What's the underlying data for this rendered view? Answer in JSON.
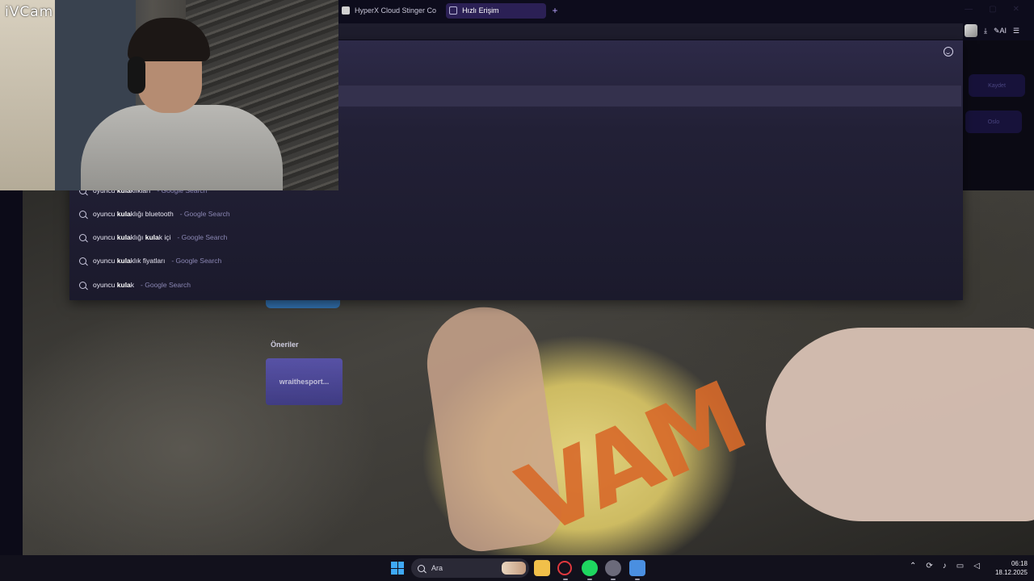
{
  "webcam": {
    "logo": "iVCam"
  },
  "tabs": [
    {
      "label": "HyperX Cloud Stinger Co",
      "active": false,
      "icon": "page-icon"
    },
    {
      "label": "Hızlı Erişim",
      "active": true,
      "icon": "grid-icon"
    }
  ],
  "new_tab_label": "+",
  "toolbar": {
    "ai_label": "AI"
  },
  "ghost_buttons": {
    "top": "Kaydet",
    "bottom": "Oslo"
  },
  "suggestions": [
    {
      "text": "oyuncu kulaklıkları",
      "bold": "kula",
      "source": "- Google Search"
    },
    {
      "text": "oyuncu kulaklığı bluetooth",
      "bold": "kula",
      "source": "- Google Search"
    },
    {
      "text": "oyuncu kulaklığı kulak içi",
      "bold": "kula",
      "source": "- Google Search"
    },
    {
      "text": "oyuncu kulaklık fiyatları",
      "bold": "kula",
      "source": "- Google Search"
    },
    {
      "text": "oyuncu kulak",
      "bold": "kula",
      "source": "- Google Search"
    }
  ],
  "speed_dial": {
    "section_label": "Öneriler",
    "card_label": "wraithesport..."
  },
  "taskbar": {
    "search_placeholder": "Ara",
    "time": "06:18",
    "date": "18.12.2025"
  },
  "colors": {
    "accent": "#2b2055",
    "dropdown": "#222036",
    "taskbar": "#12111c"
  }
}
